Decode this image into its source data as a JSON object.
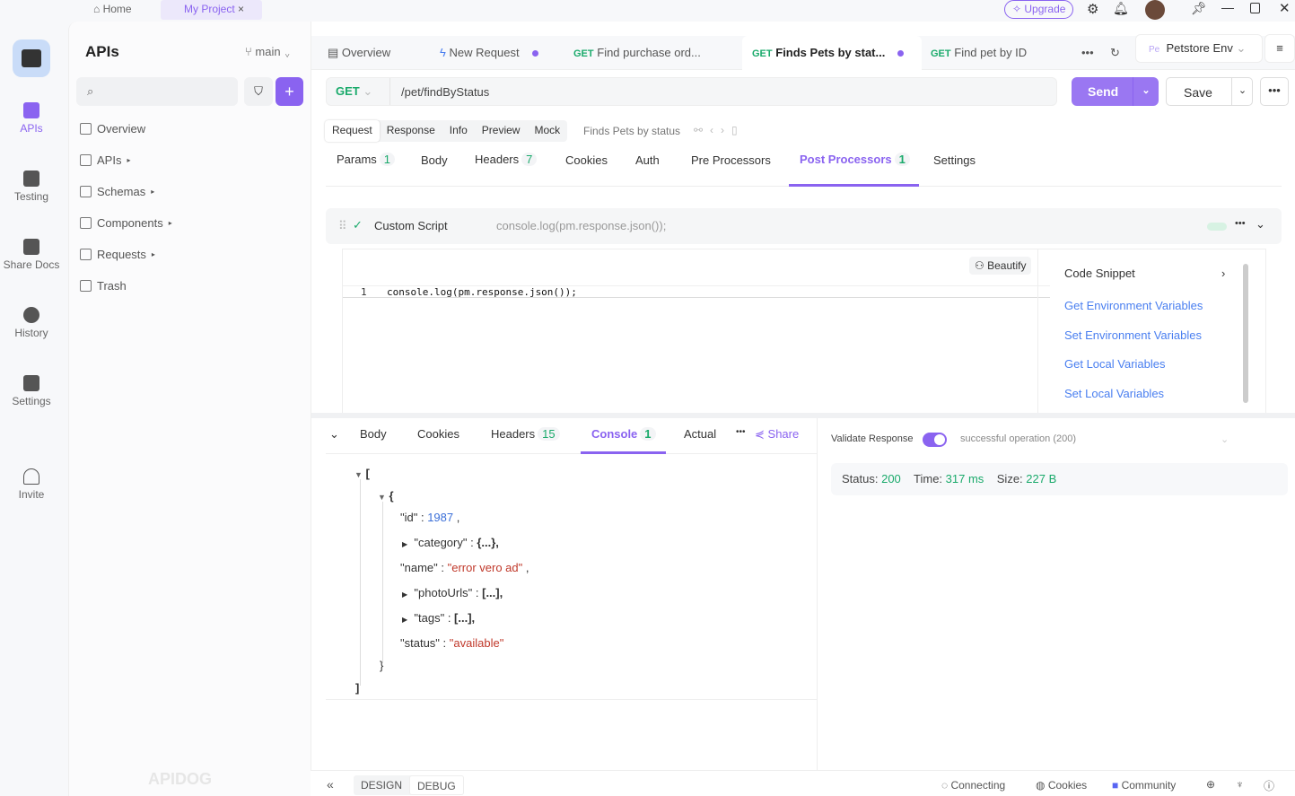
{
  "top": {
    "home": "Home",
    "project": "My Project",
    "upgrade": "Upgrade"
  },
  "rail": [
    {
      "label": "APIs"
    },
    {
      "label": "Testing"
    },
    {
      "label": "Share Docs"
    },
    {
      "label": "History"
    },
    {
      "label": "Settings"
    },
    {
      "label": "Invite"
    }
  ],
  "sidebar": {
    "title": "APIs",
    "branch": "main",
    "search_placeholder": "",
    "items": [
      {
        "label": "Overview"
      },
      {
        "label": "APIs"
      },
      {
        "label": "Schemas"
      },
      {
        "label": "Components"
      },
      {
        "label": "Requests"
      },
      {
        "label": "Trash"
      }
    ],
    "watermark": "APIDOG"
  },
  "tabs": [
    {
      "method": "",
      "label": "Overview"
    },
    {
      "method": "",
      "label": "New Request"
    },
    {
      "method": "GET",
      "label": "Find purchase ord..."
    },
    {
      "method": "GET",
      "label": "Finds Pets by stat..."
    },
    {
      "method": "GET",
      "label": "Find pet by ID"
    }
  ],
  "env": {
    "abbr": "Pe",
    "label": "Petstore Env"
  },
  "request": {
    "method": "GET",
    "url": "/pet/findByStatus",
    "send": "Send",
    "save": "Save"
  },
  "subtabs": [
    "Request",
    "Response",
    "Info",
    "Preview",
    "Mock"
  ],
  "request_name": "Finds Pets by status",
  "param_tabs": [
    {
      "label": "Params",
      "count": "1"
    },
    {
      "label": "Body",
      "count": ""
    },
    {
      "label": "Headers",
      "count": "7"
    },
    {
      "label": "Cookies",
      "count": ""
    },
    {
      "label": "Auth",
      "count": ""
    },
    {
      "label": "Pre Processors",
      "count": ""
    },
    {
      "label": "Post Processors",
      "count": "1"
    },
    {
      "label": "Settings",
      "count": ""
    }
  ],
  "script": {
    "title": "Custom Script",
    "preview": "console.log(pm.response.json());",
    "beautify": "Beautify",
    "line": "1",
    "code": "console.log(pm.response.json());",
    "enabled": true
  },
  "snippets": {
    "title": "Code Snippet",
    "items": [
      "Get Environment Variables",
      "Set Environment Variables",
      "Get Local Variables",
      "Set Local Variables"
    ]
  },
  "response_tabs": [
    {
      "label": "Body",
      "count": ""
    },
    {
      "label": "Cookies",
      "count": ""
    },
    {
      "label": "Headers",
      "count": "15"
    },
    {
      "label": "Console",
      "count": "1"
    },
    {
      "label": "Actual",
      "count": ""
    }
  ],
  "share": "Share",
  "json": {
    "open_arr": "[",
    "open_obj": "{",
    "id_key": "\"id\"",
    "id_val": "1987",
    "category": "\"category\"",
    "category_val": "{...},",
    "name_key": "\"name\"",
    "name_val": "\"error vero ad\"",
    "photo": "\"photoUrls\"",
    "photo_val": "[...],",
    "tags": "\"tags\"",
    "tags_val": "[...],",
    "status_key": "\"status\"",
    "status_val": "\"available\"",
    "close_obj": "}",
    "close_arr": "]"
  },
  "validate": {
    "label": "Validate Response",
    "on": true,
    "selected": "successful operation (200)"
  },
  "stats": {
    "status_label": "Status:",
    "status": "200",
    "time_label": "Time:",
    "time": "317 ms",
    "size_label": "Size:",
    "size": "227 B"
  },
  "bottom": {
    "design": "DESIGN",
    "debug": "DEBUG",
    "connecting": "Connecting",
    "cookies": "Cookies",
    "community": "Community"
  }
}
